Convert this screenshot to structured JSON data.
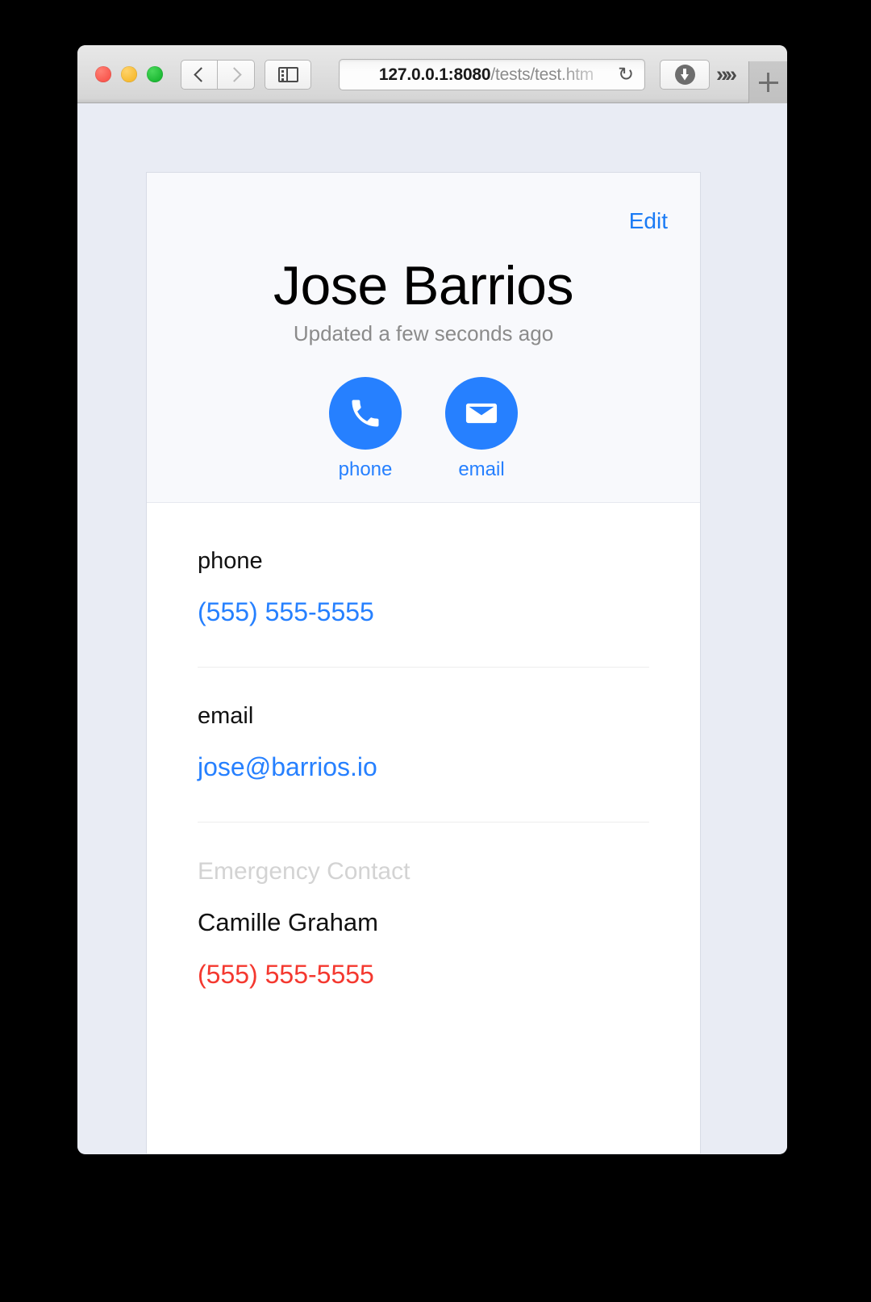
{
  "browser": {
    "traffic_lights": [
      "close",
      "minimize",
      "zoom"
    ],
    "back_label": "Back",
    "forward_label": "Forward",
    "sidebar_label": "Show Sidebar",
    "url_host": "127.0.0.1:8080",
    "url_path": "/tests/test.htm",
    "reload_icon": "↻",
    "download_label": "Downloads",
    "overflow_label": "»»",
    "newtab_label": "+"
  },
  "page": {
    "header": {
      "edit_label": "Edit",
      "name": "Jose Barrios",
      "updated": "Updated a few seconds ago",
      "actions": [
        {
          "icon": "phone-icon",
          "label": "phone"
        },
        {
          "icon": "email-icon",
          "label": "email"
        }
      ]
    },
    "fields": [
      {
        "label": "phone",
        "value": "(555) 555-5555",
        "style": "link"
      },
      {
        "label": "email",
        "value": "jose@barrios.io",
        "style": "link"
      }
    ],
    "emergency": {
      "title": "Emergency Contact",
      "name": "Camille Graham",
      "phone": "(555) 555-5555"
    }
  },
  "colors": {
    "accent": "#2680ff",
    "link": "#1a7bf5",
    "danger": "#f4382f",
    "muted": "#8b8b8b",
    "faint": "#d3d3d3",
    "page_bg": "#e9ecf4",
    "card_header_bg": "#f8f9fc"
  }
}
